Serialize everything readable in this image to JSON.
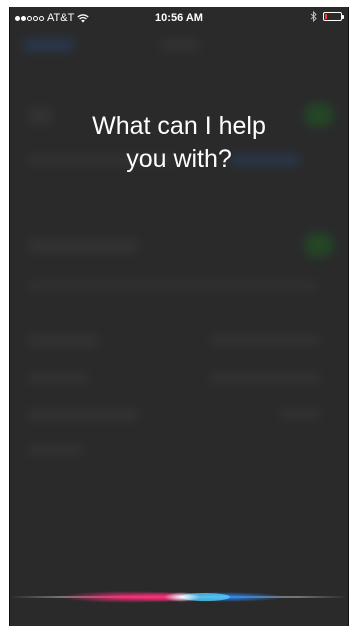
{
  "status_bar": {
    "signal_filled": 2,
    "signal_total": 5,
    "carrier": "AT&T",
    "time": "10:56 AM",
    "battery_level": 0.1,
    "battery_color": "#ff3b30"
  },
  "siri": {
    "prompt_line1": "What can I help",
    "prompt_line2": "you with?"
  },
  "colors": {
    "overlay_background": "#2a2a2b",
    "wave_pink": "#ff2d7a",
    "wave_blue": "#2a8cff",
    "wave_cyan": "#5ad8ff"
  }
}
